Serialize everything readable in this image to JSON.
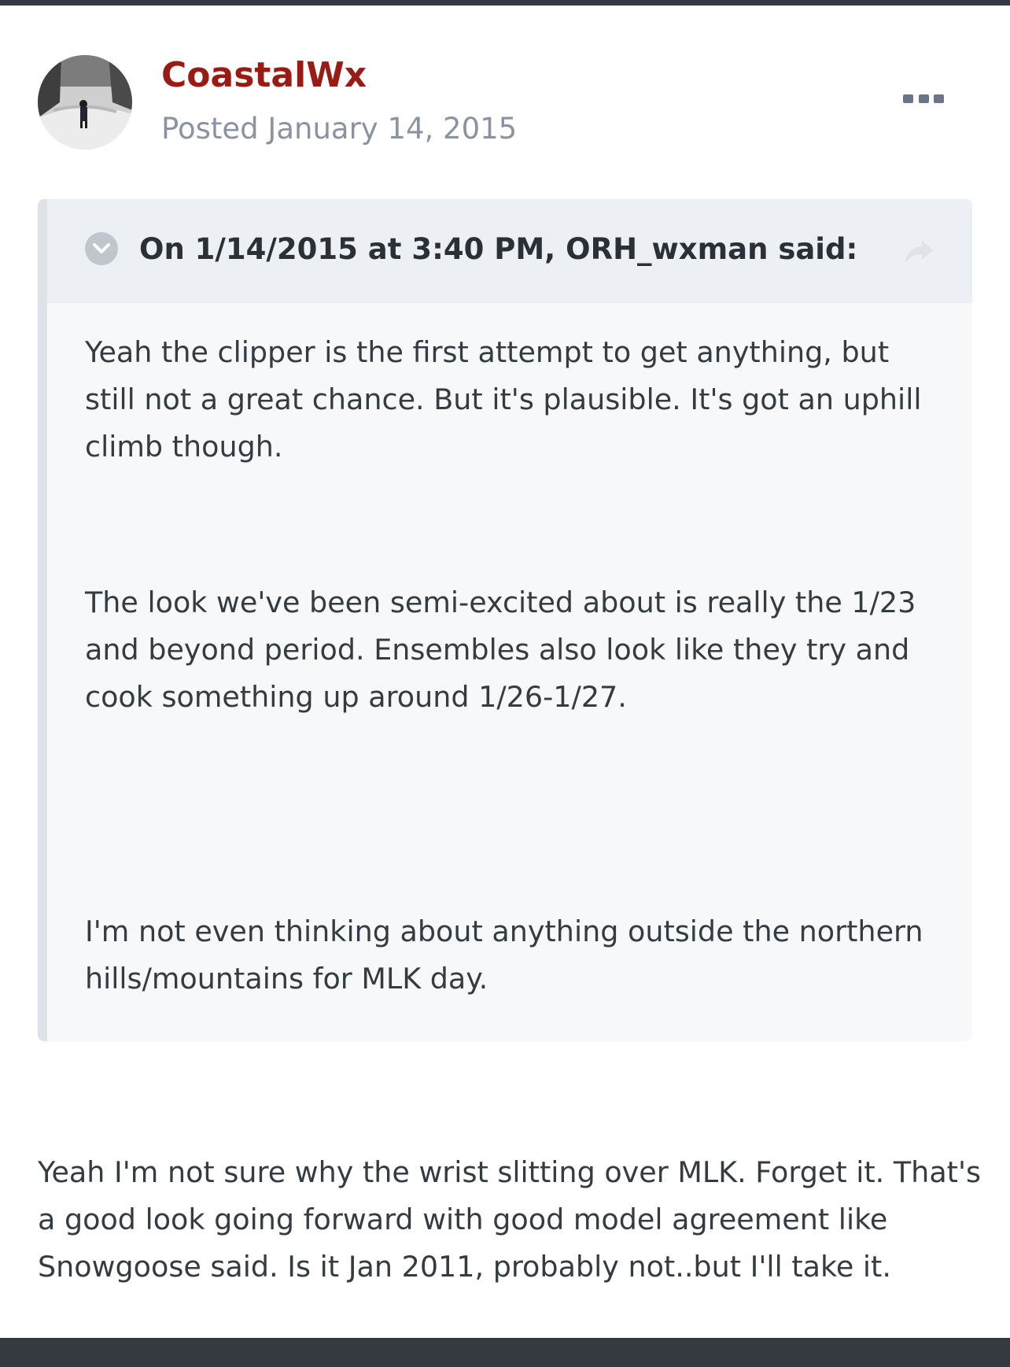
{
  "post": {
    "author": "CoastalWx",
    "date": "Posted January 14, 2015",
    "quote": {
      "citation": "On 1/14/2015 at 3:40 PM, ORH_wxman said:",
      "paragraphs": [
        "Yeah the clipper is the first attempt to get anything, but still not a great chance. But it's plausible. It's got an uphill climb though.",
        "The look we've been semi-excited about is really the 1/23 and beyond period. Ensembles also look like they try and cook something up around 1/26-1/27.",
        "I'm not even thinking about anything outside the northern hills/mountains for MLK day."
      ]
    },
    "body": "Yeah I'm not sure why the wrist slitting over MLK. Forget it. That's a good look going forward with good model agreement like Snowgoose said. Is it Jan 2011, probably not..but I'll take it."
  },
  "icons": {
    "more": "more-options-icon",
    "toggle": "chevron-down-icon",
    "share": "share-arrow-icon"
  },
  "colors": {
    "author": "#9a1a14",
    "date": "#8a93a1",
    "quote_background": "#f7f8fa",
    "quote_header_background": "#eceff3",
    "bar": "#353a40"
  }
}
